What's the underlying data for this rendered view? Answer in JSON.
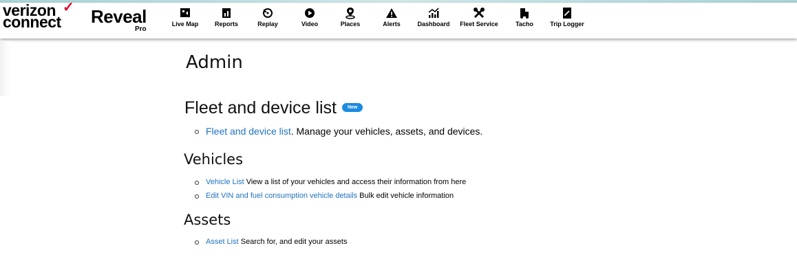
{
  "brand": {
    "logo_line1": "verizon",
    "logo_line2": "connect",
    "logo_check": "✓",
    "product": "Reveal",
    "product_tier": "Pro"
  },
  "nav": [
    {
      "label": "Live Map",
      "icon": "live-map-icon"
    },
    {
      "label": "Reports",
      "icon": "reports-icon"
    },
    {
      "label": "Replay",
      "icon": "replay-icon"
    },
    {
      "label": "Video",
      "icon": "video-icon"
    },
    {
      "label": "Places",
      "icon": "places-icon"
    },
    {
      "label": "Alerts",
      "icon": "alerts-icon"
    },
    {
      "label": "Dashboard",
      "icon": "dashboard-icon"
    },
    {
      "label": "Fleet Service",
      "icon": "fleet-service-icon"
    },
    {
      "label": "Tacho",
      "icon": "tacho-icon"
    },
    {
      "label": "Trip Logger",
      "icon": "trip-logger-icon"
    }
  ],
  "page": {
    "title": "Admin"
  },
  "fleet_section": {
    "heading": "Fleet and device list",
    "badge": "New",
    "item": {
      "link": "Fleet and device list",
      "text": ". Manage your vehicles, assets, and devices."
    }
  },
  "vehicles_section": {
    "heading": "Vehicles",
    "items": [
      {
        "link": "Vehicle List",
        "text": " View a list of your vehicles and access their information from here"
      },
      {
        "link": "Edit VIN and fuel consumption vehicle details",
        "text": " Bulk edit vehicle information"
      }
    ]
  },
  "assets_section": {
    "heading": "Assets",
    "items": [
      {
        "link": "Asset List",
        "text": " Search for, and edit your assets"
      }
    ]
  },
  "colors": {
    "link": "#1f72bf",
    "badge": "#1b8be0",
    "brand_check": "#e4002b"
  }
}
